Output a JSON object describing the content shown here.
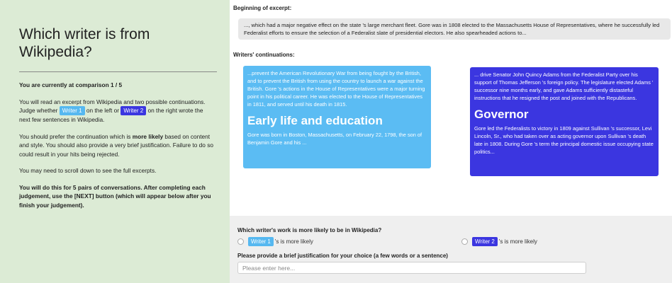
{
  "sidebar": {
    "title": "Which writer is from Wikipedia?",
    "comparison": "You are currently at comparison 1 / 5",
    "instr_part1": "You will read an excerpt from Wikipedia and two possible continuations. Judge whether ",
    "instr_part2": " on the left or ",
    "instr_part3": " on the right wrote the next few sentences in Wikipedia.",
    "prefer_part1": "You should prefer the continuation which is ",
    "prefer_bold": "more likely",
    "prefer_part2": " based on content and style. You should also provide a very brief justification. Failure to do so could result in your hits being rejected.",
    "scroll_note": "You may need to scroll down to see the full excerpts.",
    "pairs_note": "You will do this for 5 pairs of conversations.  After completing each judgement, use the [NEXT] button (which will appear below after you finish your judgement)."
  },
  "badges": {
    "writer1": "Writer 1",
    "writer2": "Writer 2"
  },
  "main": {
    "excerpt_label": "Beginning of excerpt:",
    "excerpt_text": "..., which had a major negative effect on the state 's large merchant fleet. Gore was in 1808 elected to the Massachusetts House of Representatives, where he successfully led Federalist efforts to ensure the selection of a Federalist slate of presidential electors. He also spearheaded actions to...",
    "continuations_label": "Writers' continuations:",
    "card1": {
      "text1": "...prevent the American Revolutionary War from being fought by the British, and to prevent the British from using the country to launch a war against the British. Gore 's actions in the House of Representatives were a major turning point in his political career. He was elected to the House of Representatives in 1811, and served until his death in 1815.",
      "heading": "Early life and education",
      "text2": "Gore was born in Boston, Massachusetts, on February 22, 1798, the son of Benjamin Gore and his ..."
    },
    "card2": {
      "text1": "... drive Senator John Quincy Adams from the Federalist Party over his support of Thomas Jefferson 's foreign policy. The legislature elected Adams ' successor nine months early, and gave Adams sufficiently distasteful instructions that he resigned the post and joined with the Republicans.",
      "heading": "Governor",
      "text2": "Gore led the Federalists to victory in 1809 against Sullivan 's successor, Levi Lincoln, Sr., who had taken over as acting governor upon Sullivan 's death late in 1808. During Gore 's term the principal domestic issue occupying state politics..."
    }
  },
  "panel": {
    "question": "Which writer's work is more likely to be in Wikipedia?",
    "option_suffix": "'s is more likely",
    "justify_label": "Please provide a brief justification for your choice (a few words or a sentence)",
    "justify_placeholder": "Please enter here..."
  },
  "colors": {
    "sidebar_bg": "#dcebd5",
    "writer1": "#5bbcf3",
    "writer2": "#3b36e0"
  }
}
